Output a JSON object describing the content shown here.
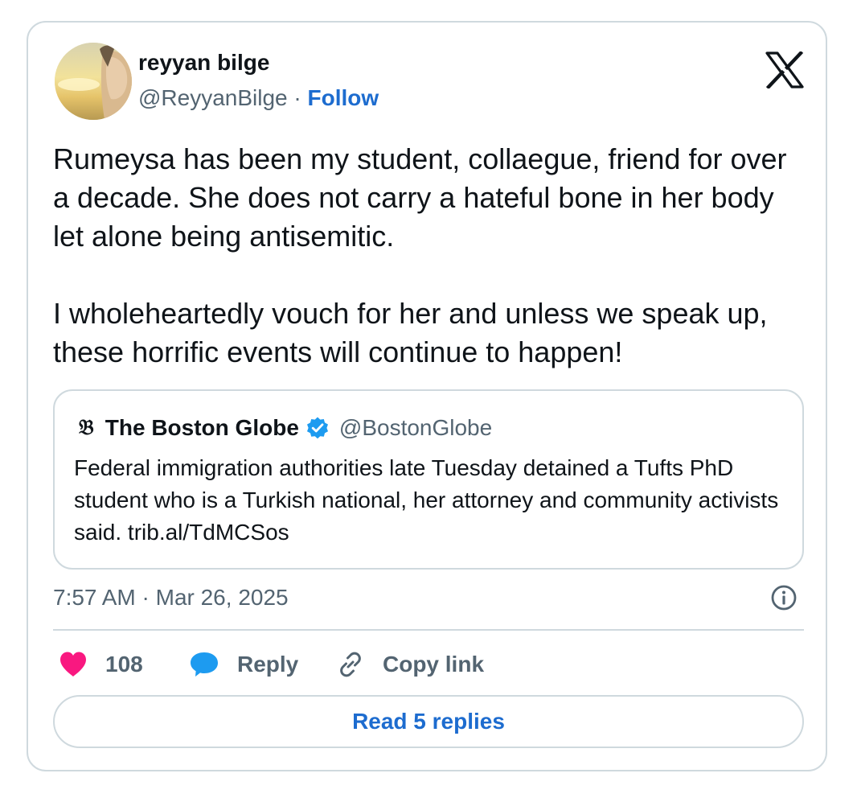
{
  "author": {
    "name": "reyyan bilge",
    "handle": "@ReyyanBilge",
    "separator": "·",
    "follow_label": "Follow"
  },
  "tweet": {
    "text": "Rumeysa has been my student, collaegue, friend for over a decade. She does not carry a hateful bone in her body let alone being antisemitic.\n\nI wholeheartedly vouch for her and unless we speak up, these horrific events will continue to happen!"
  },
  "quote": {
    "logo_glyph": "𝔅",
    "name": "The Boston Globe",
    "handle": "@BostonGlobe",
    "text": "Federal immigration authorities late Tuesday detained a Tufts PhD student who is a Turkish national, her attorney and community activists said. trib.al/TdMCSos"
  },
  "timestamp": "7:57 AM · Mar 26, 2025",
  "actions": {
    "like_count": "108",
    "reply_label": "Reply",
    "copy_label": "Copy link"
  },
  "read_replies_label": "Read 5 replies",
  "icons": {
    "platform": "x-logo-icon",
    "verified": "verified-badge-icon",
    "info": "info-icon",
    "like": "heart-icon",
    "reply": "speech-bubble-icon",
    "copy": "link-icon"
  },
  "colors": {
    "link_blue": "#1d6ccf",
    "verified_blue": "#1d9bf0",
    "like_pink": "#f91880",
    "secondary_text": "#536471",
    "border": "#cfd9de"
  }
}
